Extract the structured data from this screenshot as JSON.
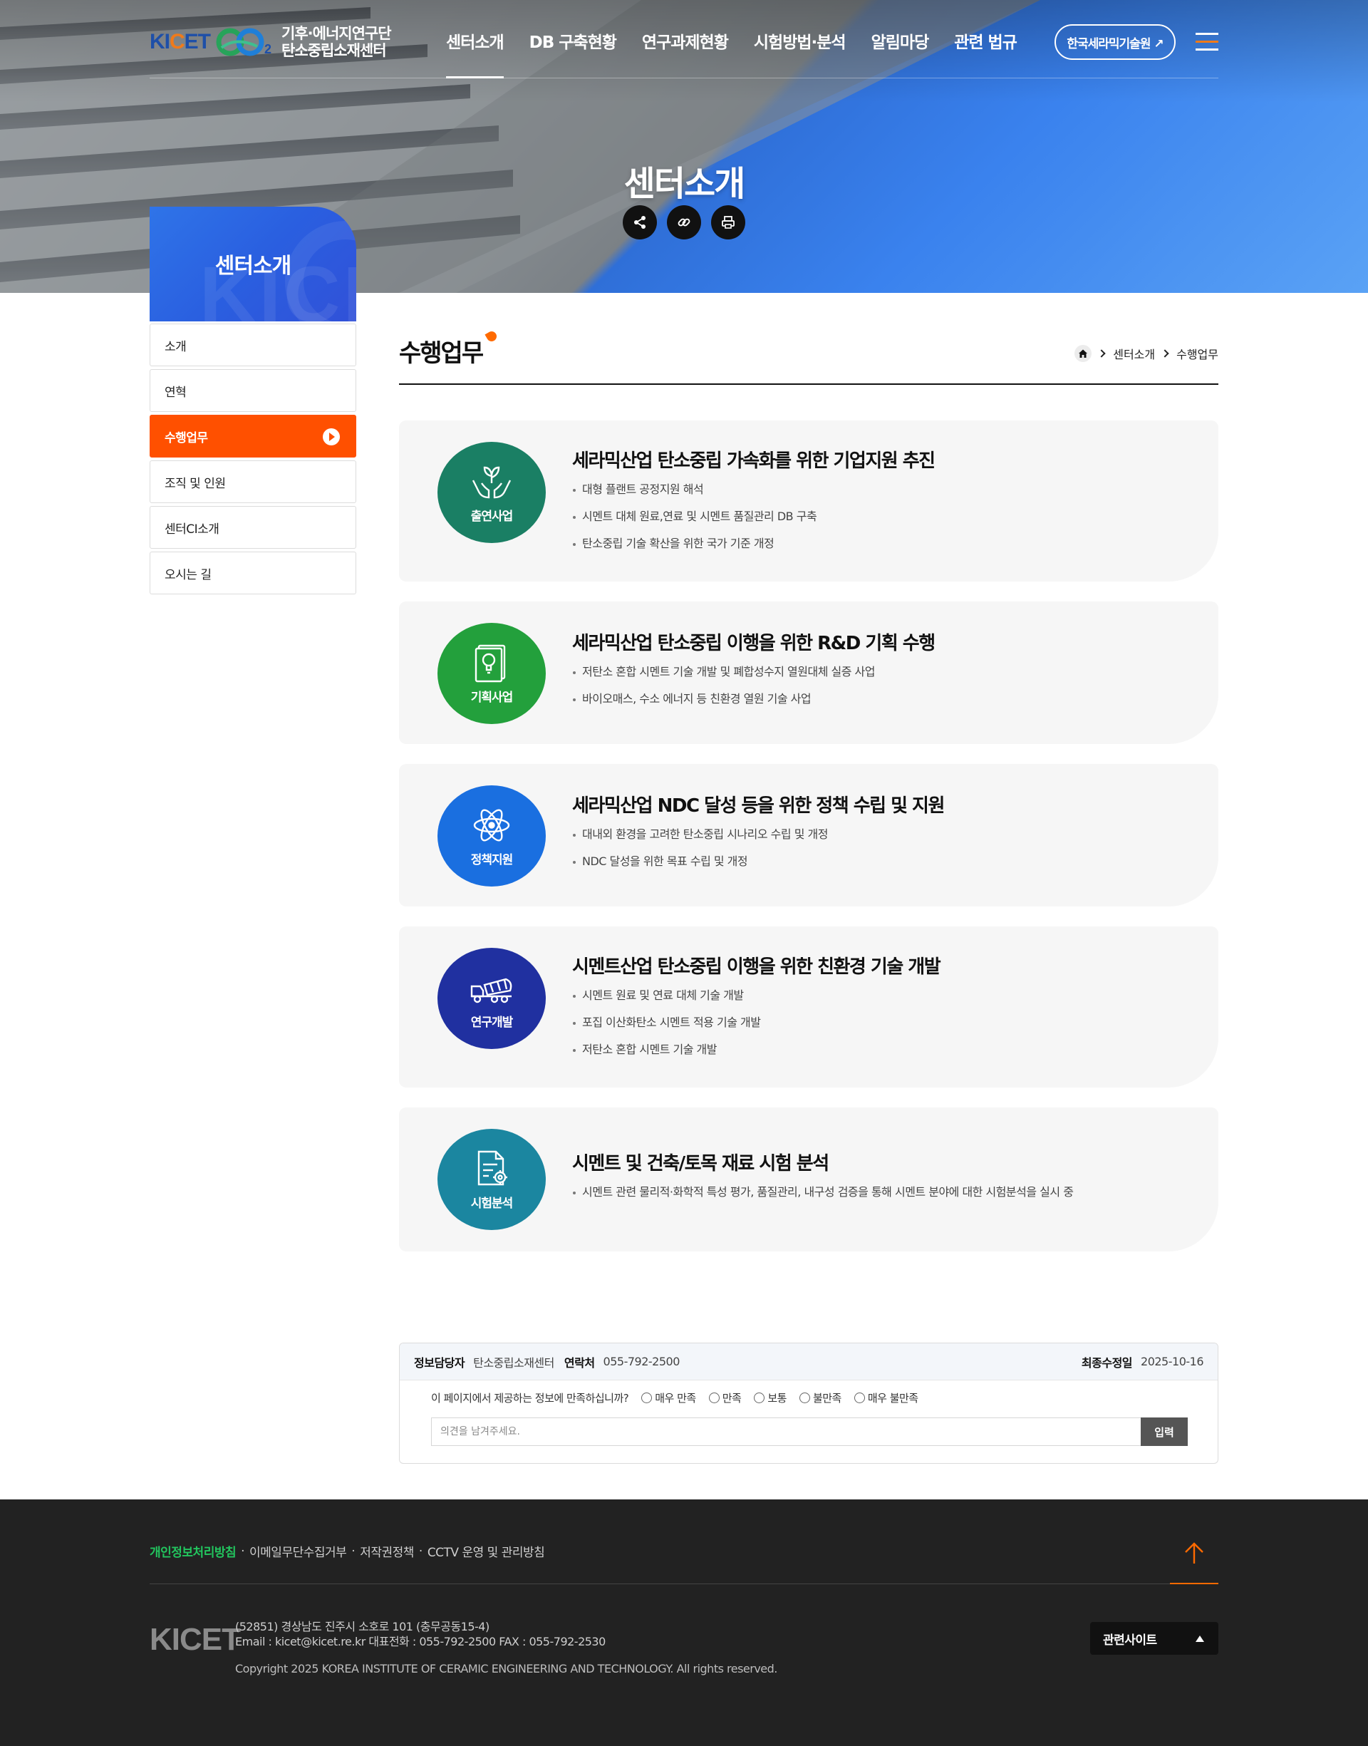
{
  "header": {
    "logo": {
      "kicet_pre": "KI",
      "kicet_c": "C",
      "kicet_post": "ET",
      "co2_sub": "2",
      "line1": "기후·에너지연구단",
      "line2": "탄소중립소재센터"
    },
    "nav": [
      "센터소개",
      "DB 구축현황",
      "연구과제현황",
      "시험방법·분석",
      "알림마당",
      "관련 법규"
    ],
    "external_button": "한국세라믹기술원 ↗"
  },
  "hero": {
    "title": "센터소개"
  },
  "lnb": {
    "title": "센터소개",
    "watermark": "KICET",
    "items": [
      "소개",
      "연혁",
      "수행업무",
      "조직 및 인원",
      "센터CI소개",
      "오시는 길"
    ]
  },
  "content": {
    "title": "수행업무",
    "breadcrumb": [
      "센터소개",
      "수행업무"
    ],
    "cards": [
      {
        "badge": "출연사업",
        "icon": "hands-plant-icon",
        "color": "#1a7f64",
        "title": "세라믹산업 탄소중립 가속화를 위한 기업지원 추진",
        "items": [
          "대형 플랜트 공정지원 해석",
          "시멘트 대체 원료,연료 및 시멘트 품질관리 DB 구축",
          "탄소중립 기술 확산을 위한 국가 기준 개정"
        ]
      },
      {
        "badge": "기획사업",
        "icon": "lightbulb-document-icon",
        "color": "#23a03c",
        "title": "세라믹산업 탄소중립 이행을 위한 R&D 기획 수행",
        "items": [
          "저탄소 혼합 시멘트 기술 개발 및 폐합성수지 열원대체 실증 사업",
          "바이오매스, 수소 에너지 등 친환경 열원 기술 사업"
        ]
      },
      {
        "badge": "정책지원",
        "icon": "atom-icon",
        "color": "#1a6fe0",
        "title": "세라믹산업 NDC 달성 등을 위한 정책 수립 및 지원",
        "items": [
          "대내외 환경을 고려한 탄소중립 시나리오 수립 및 개정",
          "NDC 달성을 위한 목표 수립 및 개정"
        ]
      },
      {
        "badge": "연구개발",
        "icon": "mixer-truck-icon",
        "color": "#2030a0",
        "title": "시멘트산업 탄소중립 이행을 위한 친환경 기술 개발",
        "items": [
          "시멘트 원료 및 연료 대체 기술 개발",
          "포집 이산화탄소 시멘트 적용 기술 개발",
          "저탄소 혼합 시멘트 기술 개발"
        ]
      },
      {
        "badge": "시험분석",
        "icon": "document-gear-icon",
        "color": "#1b86a0",
        "title": "시멘트 및 건축/토목 재료 시험 분석",
        "items": [
          "시멘트 관련 물리적·화학적 특성 평가, 품질관리, 내구성 검증을 통해 시멘트 분야에 대한 시험분석을 실시 중"
        ]
      }
    ]
  },
  "survey": {
    "manager_label": "정보담당자",
    "manager": "탄소중립소재센터",
    "contact_label": "연락처",
    "contact": "055-792-2500",
    "updated_label": "최종수정일",
    "updated": "2025-10-16",
    "question": "이 페이지에서 제공하는 정보에 만족하십니까?",
    "options": [
      "매우 만족",
      "만족",
      "보통",
      "불만족",
      "매우 불만족"
    ],
    "placeholder": "의견을 남겨주세요.",
    "submit": "입력"
  },
  "footer": {
    "links": [
      "개인정보처리방침",
      "이메일무단수집거부",
      "저작권정책",
      "CCTV 운영 및 관리방침"
    ],
    "logo": "KICET",
    "address": "(52851) 경상남도 진주시 소호로 101 (충무공동15-4)",
    "contact": "Email : kicet@kicet.re.kr 대표전화 : 055-792-2500 FAX : 055-792-2530",
    "copyright": "Copyright 2025 KOREA INSTITUTE OF CERAMIC ENGINEERING AND TECHNOLOGY. All rights reserved.",
    "related_sites": "관련사이트"
  }
}
